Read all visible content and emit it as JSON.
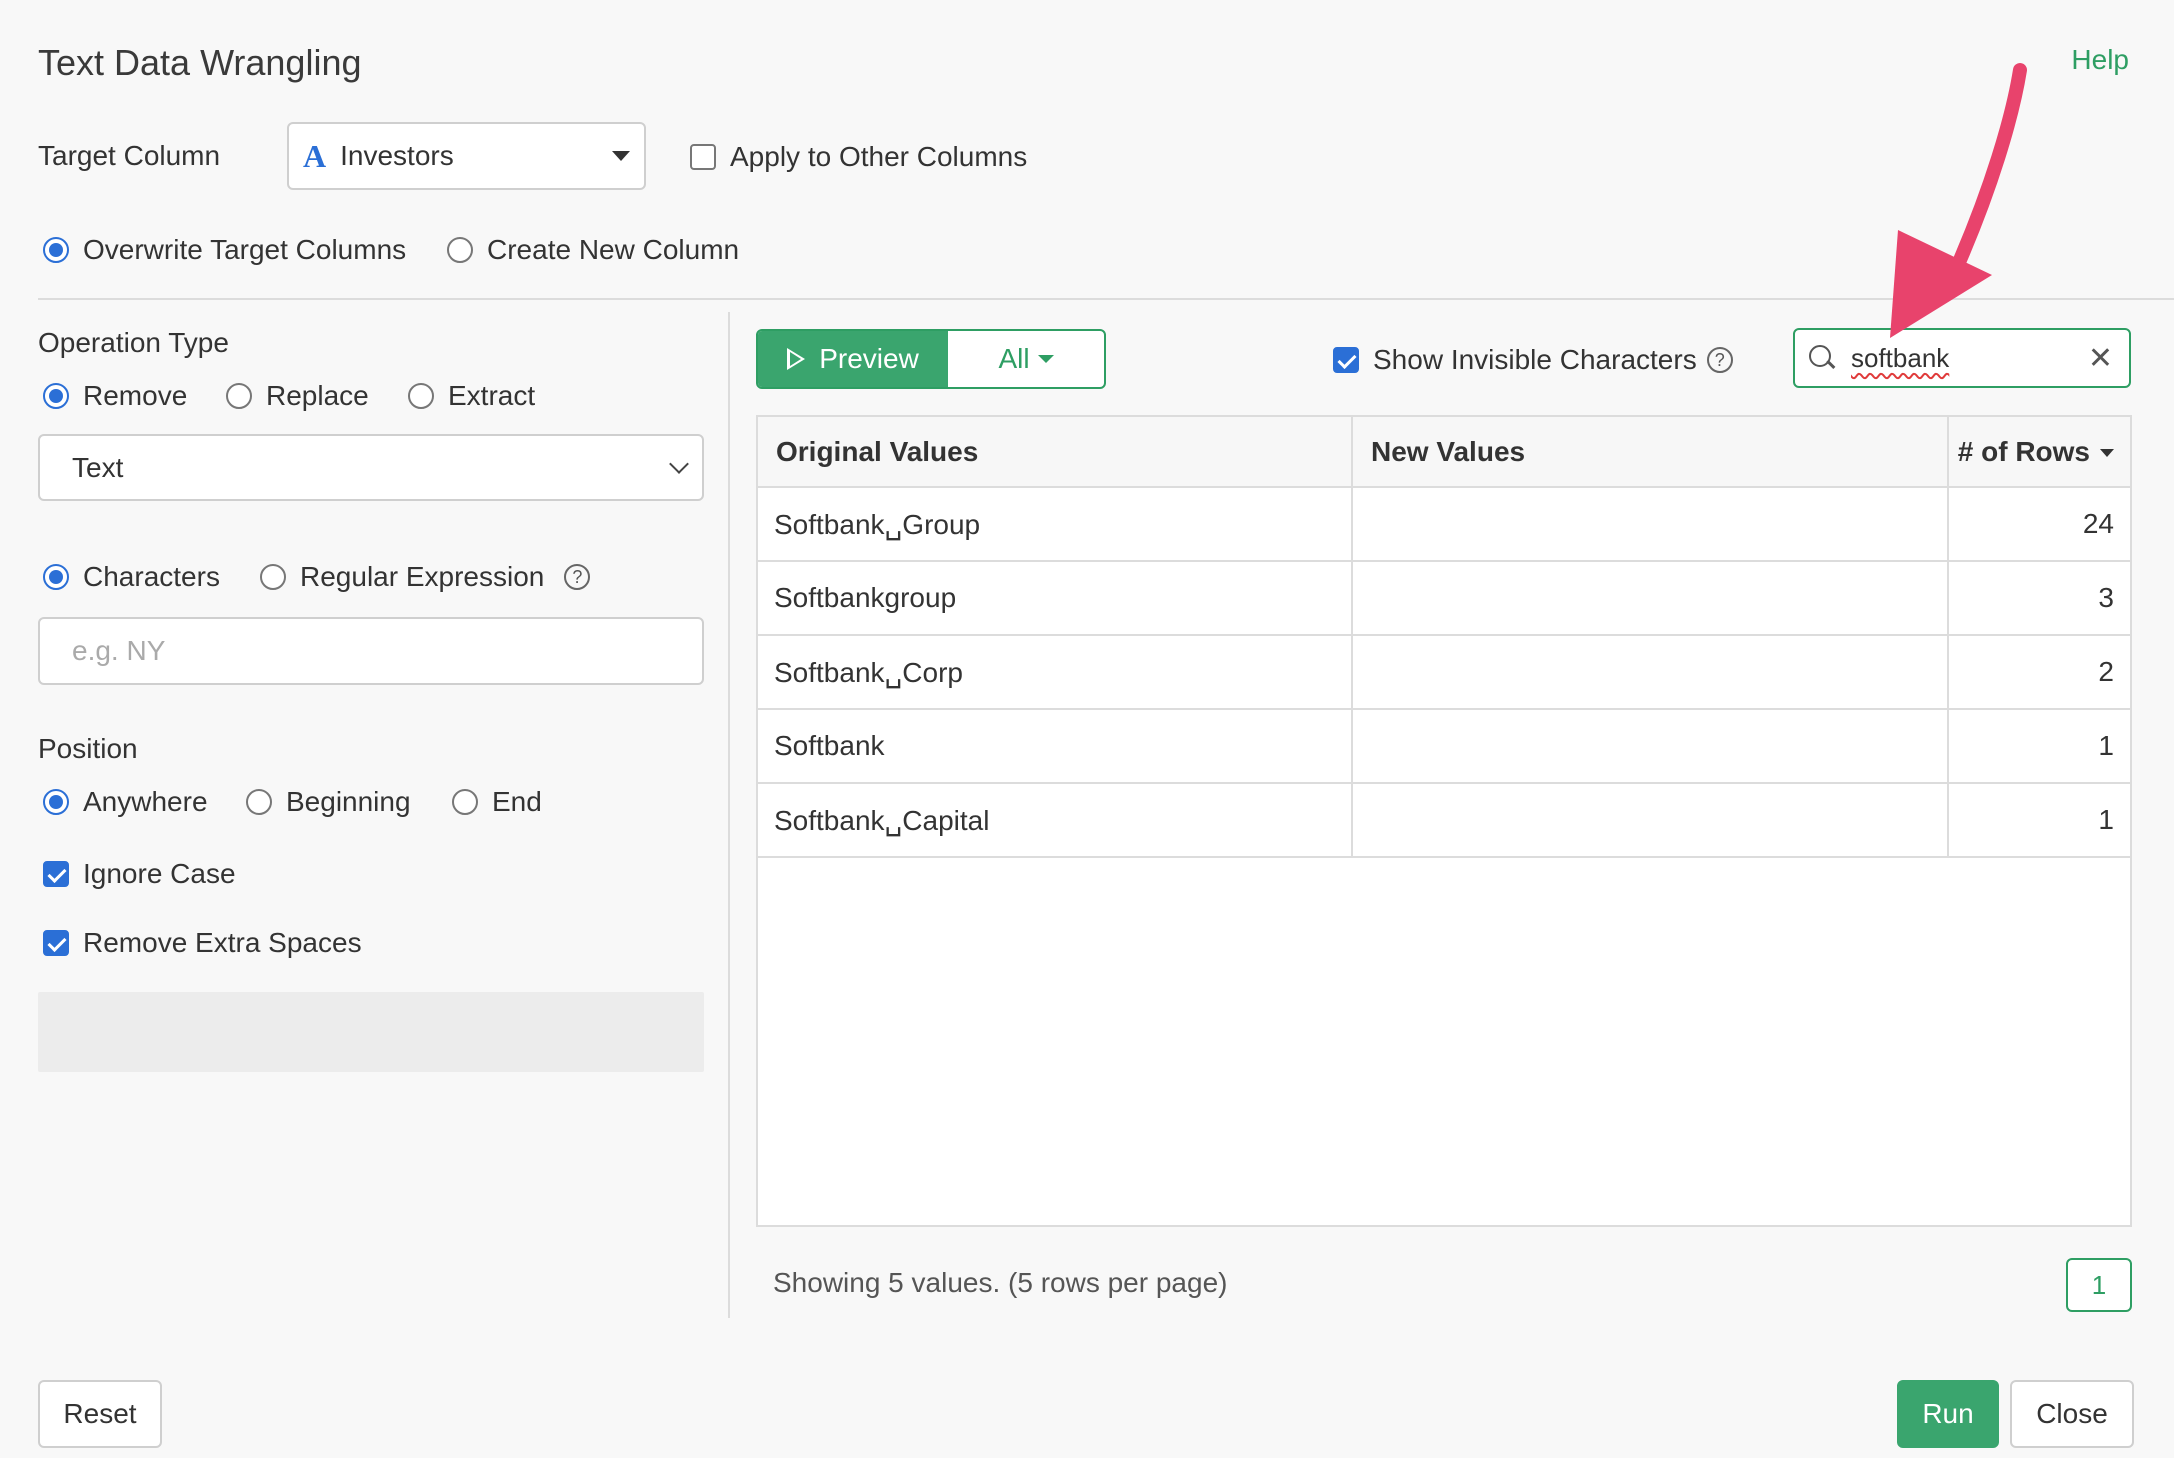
{
  "dialog": {
    "title": "Text Data Wrangling",
    "help": "Help"
  },
  "target": {
    "label": "Target Column",
    "type_icon": "A",
    "selected_column": "Investors",
    "apply_other_label": "Apply to Other Columns",
    "apply_other_checked": false,
    "overwrite_label": "Overwrite Target Columns",
    "create_new_label": "Create New Column",
    "mode": "overwrite"
  },
  "operation": {
    "heading": "Operation Type",
    "remove_label": "Remove",
    "replace_label": "Replace",
    "extract_label": "Extract",
    "selected": "remove",
    "type_select": "Text",
    "characters_label": "Characters",
    "regex_label": "Regular Expression",
    "match_mode": "characters",
    "pattern_placeholder": "e.g. NY",
    "pattern_value": ""
  },
  "position": {
    "heading": "Position",
    "anywhere_label": "Anywhere",
    "beginning_label": "Beginning",
    "end_label": "End",
    "selected": "anywhere",
    "ignore_case_label": "Ignore Case",
    "ignore_case_checked": true,
    "remove_spaces_label": "Remove Extra Spaces",
    "remove_spaces_checked": true
  },
  "preview": {
    "preview_label": "Preview",
    "filter_label": "All",
    "show_invisible_label": "Show Invisible Characters",
    "show_invisible_checked": true,
    "search_value": "softbank",
    "columns": [
      "Original Values",
      "New Values",
      "# of Rows"
    ],
    "rows": [
      {
        "original": "Softbank␣Group",
        "new": "",
        "count": "24"
      },
      {
        "original": "Softbankgroup",
        "new": "",
        "count": "3"
      },
      {
        "original": "Softbank␣Corp",
        "new": "",
        "count": "2"
      },
      {
        "original": "Softbank",
        "new": "",
        "count": "1"
      },
      {
        "original": "Softbank␣Capital",
        "new": "",
        "count": "1"
      }
    ],
    "status": "Showing 5 values. (5 rows per page)",
    "page": "1"
  },
  "footer": {
    "reset_label": "Reset",
    "run_label": "Run",
    "close_label": "Close"
  },
  "colors": {
    "accent_green": "#3aa56e",
    "check_blue": "#2b6fd6",
    "arrow_pink": "#e8436c"
  }
}
